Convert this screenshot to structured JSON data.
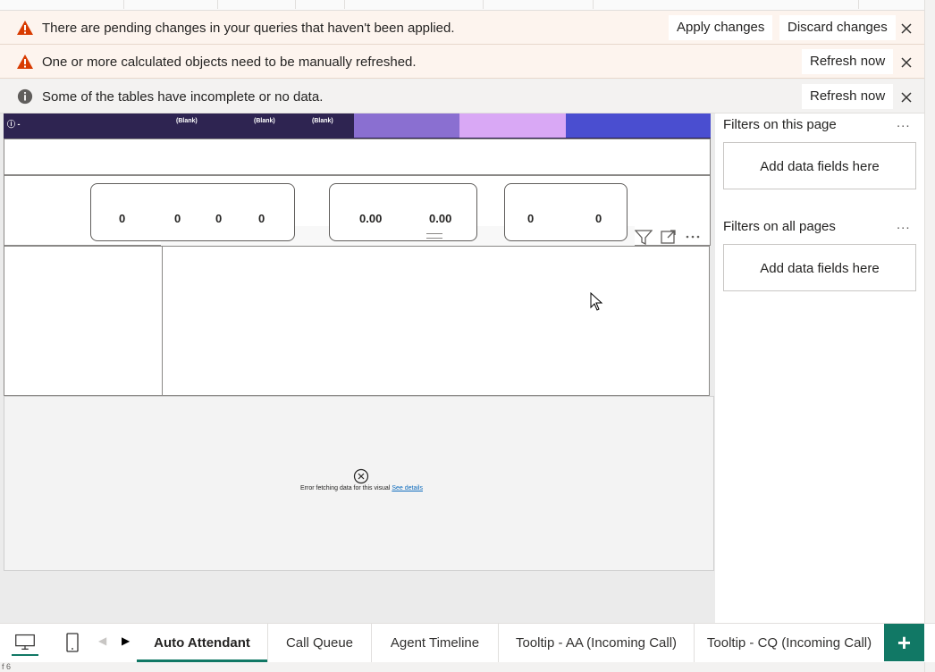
{
  "banners": [
    {
      "type": "warning",
      "text": "There are pending changes in your queries that haven't been applied.",
      "buttons": [
        "Apply changes",
        "Discard changes"
      ]
    },
    {
      "type": "warning",
      "text": "One or more calculated objects need to be manually refreshed.",
      "buttons": [
        "Refresh now"
      ]
    },
    {
      "type": "info",
      "text": "Some of the tables have incomplete or no data.",
      "buttons": [
        "Refresh now"
      ]
    }
  ],
  "visual_header": {
    "info_label": "-",
    "blank_labels": [
      "(Blank)",
      "(Blank)",
      "(Blank)"
    ]
  },
  "cards": {
    "card1": [
      "0",
      "0",
      "0",
      "0"
    ],
    "card2": [
      "0.00",
      "0.00"
    ],
    "card3": [
      "0",
      "0"
    ]
  },
  "error_visual": {
    "message": "Error fetching data for this visual",
    "link": "See details"
  },
  "filters": {
    "page_title": "Filters on this page",
    "page_placeholder": "Add data fields here",
    "all_title": "Filters on all pages",
    "all_placeholder": "Add data fields here",
    "more": "..."
  },
  "tabs": [
    "Auto Attendant",
    "Call Queue",
    "Agent Timeline",
    "Tooltip - AA (Incoming Call)",
    "Tooltip - CQ (Incoming Call)"
  ],
  "active_tab": "Auto Attendant",
  "add_tab": "+",
  "status_text": "f 6",
  "colors": {
    "accent": "#117865",
    "header_dark": "#2e2451",
    "seg_purple": "#8a6fd1",
    "seg_lilac": "#d9a8f5",
    "seg_blue": "#4a4ed0",
    "warning": "#d83b01"
  }
}
